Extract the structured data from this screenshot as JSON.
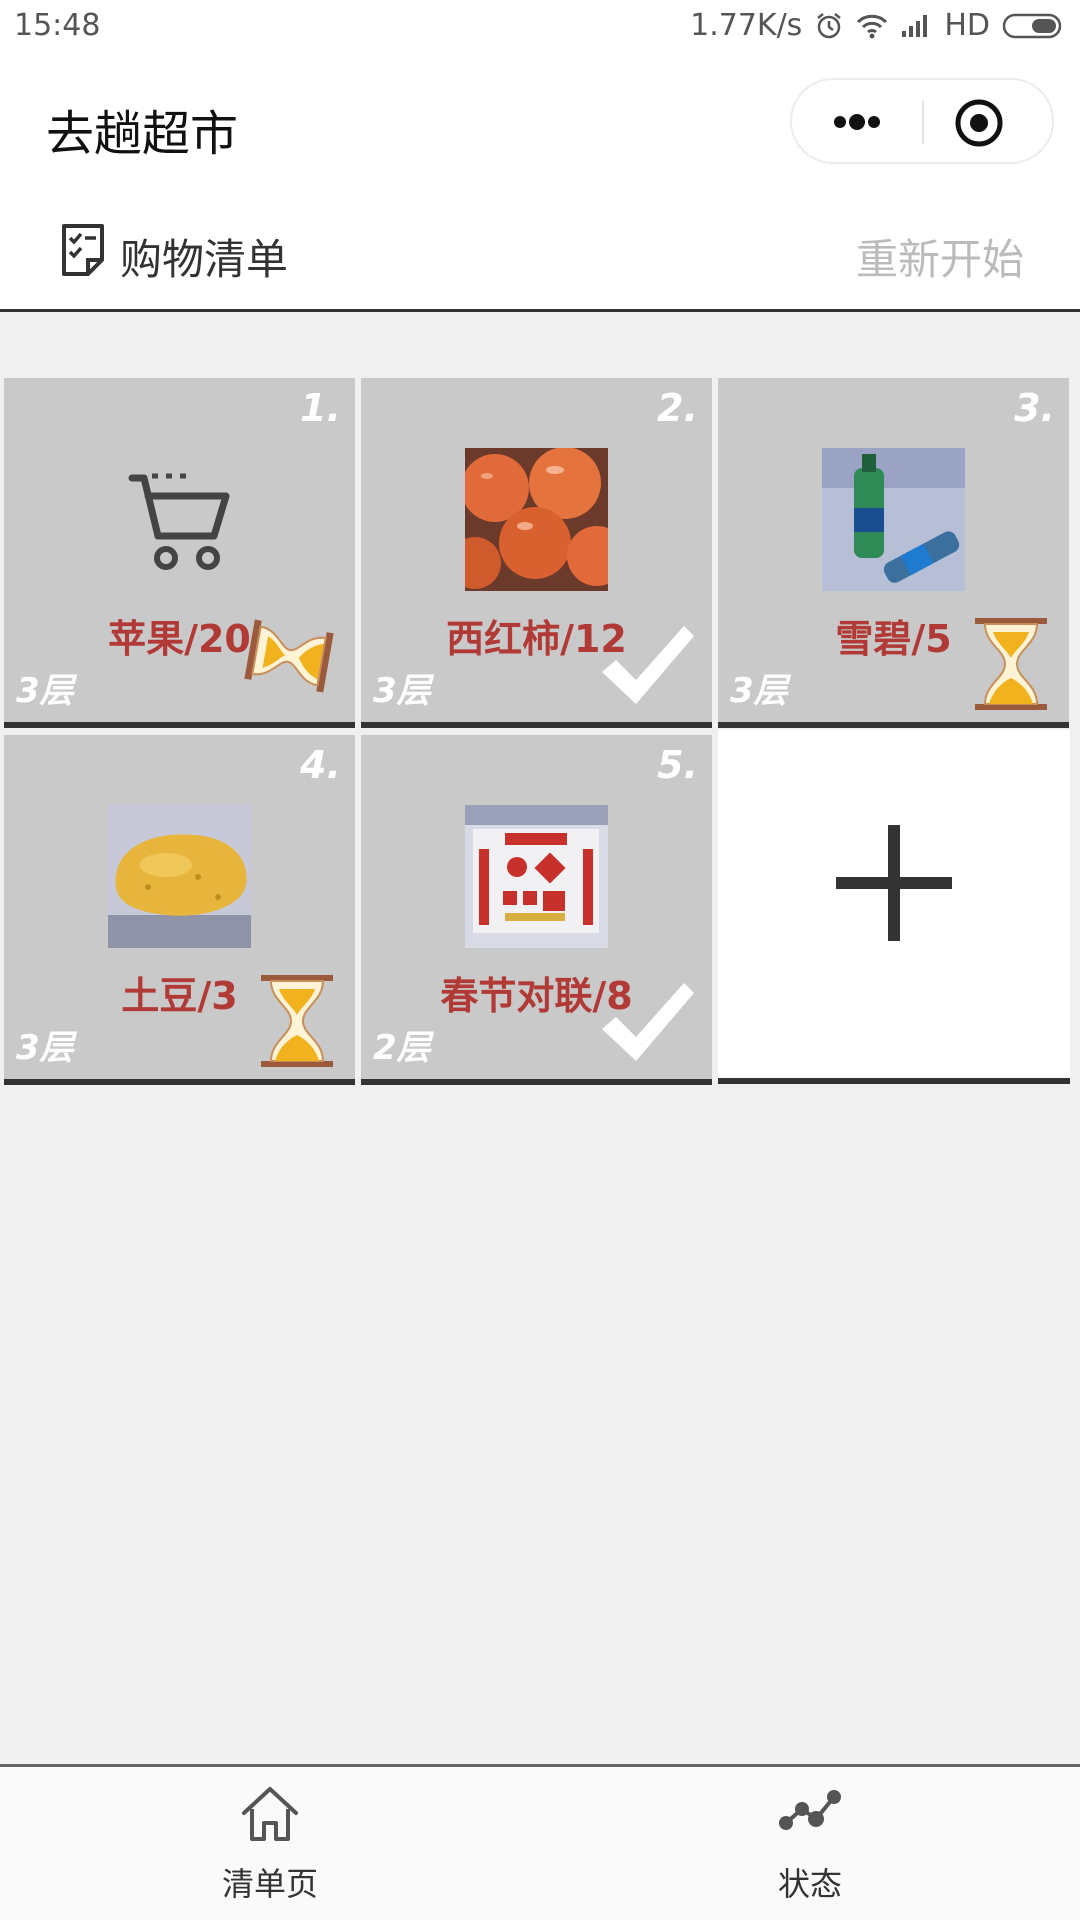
{
  "status_bar": {
    "time": "15:48",
    "net_speed": "1.77K/s",
    "network": "HD"
  },
  "app": {
    "title": "去趟超市"
  },
  "list_header": {
    "label": "购物清单",
    "restart_label": "重新开始"
  },
  "items": [
    {
      "index": "1.",
      "name": "苹果/20",
      "floor": "3层",
      "thumb": "cart-placeholder-icon",
      "status": "pending"
    },
    {
      "index": "2.",
      "name": "西红柿/12",
      "floor": "3层",
      "thumb": "tomato-photo",
      "status": "done"
    },
    {
      "index": "3.",
      "name": "雪碧/5",
      "floor": "3层",
      "thumb": "sprite-bottle-photo",
      "status": "pending"
    },
    {
      "index": "4.",
      "name": "土豆/3",
      "floor": "3层",
      "thumb": "potato-photo",
      "status": "pending"
    },
    {
      "index": "5.",
      "name": "春节对联/8",
      "floor": "2层",
      "thumb": "couplets-photo",
      "status": "done"
    }
  ],
  "add_tile": {
    "icon": "plus-icon"
  },
  "tabs": [
    {
      "label": "清单页",
      "icon": "home-icon"
    },
    {
      "label": "状态",
      "icon": "chart-icon"
    }
  ],
  "colors": {
    "item_name": "#b23a36",
    "tile_bg": "#c9c9c9",
    "hourglass_sand": "#f2b21e",
    "hourglass_frame": "#9b5a3c"
  }
}
